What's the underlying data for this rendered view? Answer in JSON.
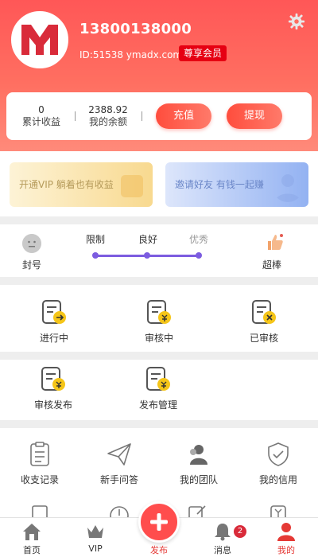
{
  "profile": {
    "phone": "13800138000",
    "uid": "ID:51538 ymadx.com",
    "vip_badge": "尊享会员"
  },
  "stats": {
    "earnings_value": "0",
    "earnings_label": "累计收益",
    "balance_value": "2388.92",
    "balance_label": "我的余额",
    "recharge_label": "充值",
    "withdraw_label": "提现"
  },
  "promos": {
    "vip_text": "开通VIP 躺着也有收益",
    "invite_text": "邀请好友 有钱一起赚"
  },
  "credit": {
    "left_label": "封号",
    "right_label": "超棒",
    "scale": [
      "限制",
      "良好",
      "优秀"
    ]
  },
  "task_grid": [
    {
      "label": "进行中",
      "icon": "task-in-progress-icon"
    },
    {
      "label": "审核中",
      "icon": "task-reviewing-icon"
    },
    {
      "label": "已审核",
      "icon": "task-reviewed-icon"
    }
  ],
  "publish_grid": [
    {
      "label": "审核发布",
      "icon": "review-publish-icon"
    },
    {
      "label": "发布管理",
      "icon": "publish-manage-icon"
    }
  ],
  "tools_grid": [
    {
      "label": "收支记录",
      "icon": "clipboard-icon"
    },
    {
      "label": "新手问答",
      "icon": "paper-plane-icon"
    },
    {
      "label": "我的团队",
      "icon": "team-icon"
    },
    {
      "label": "我的信用",
      "icon": "shield-icon"
    }
  ],
  "tabbar": {
    "home": "首页",
    "vip": "VIP",
    "publish": "发布",
    "messages": "消息",
    "mine": "我的",
    "message_count": "2"
  },
  "colors": {
    "brand_red": "#ff5757",
    "accent_purple": "#7c5ce0",
    "badge_red": "#e60012"
  }
}
